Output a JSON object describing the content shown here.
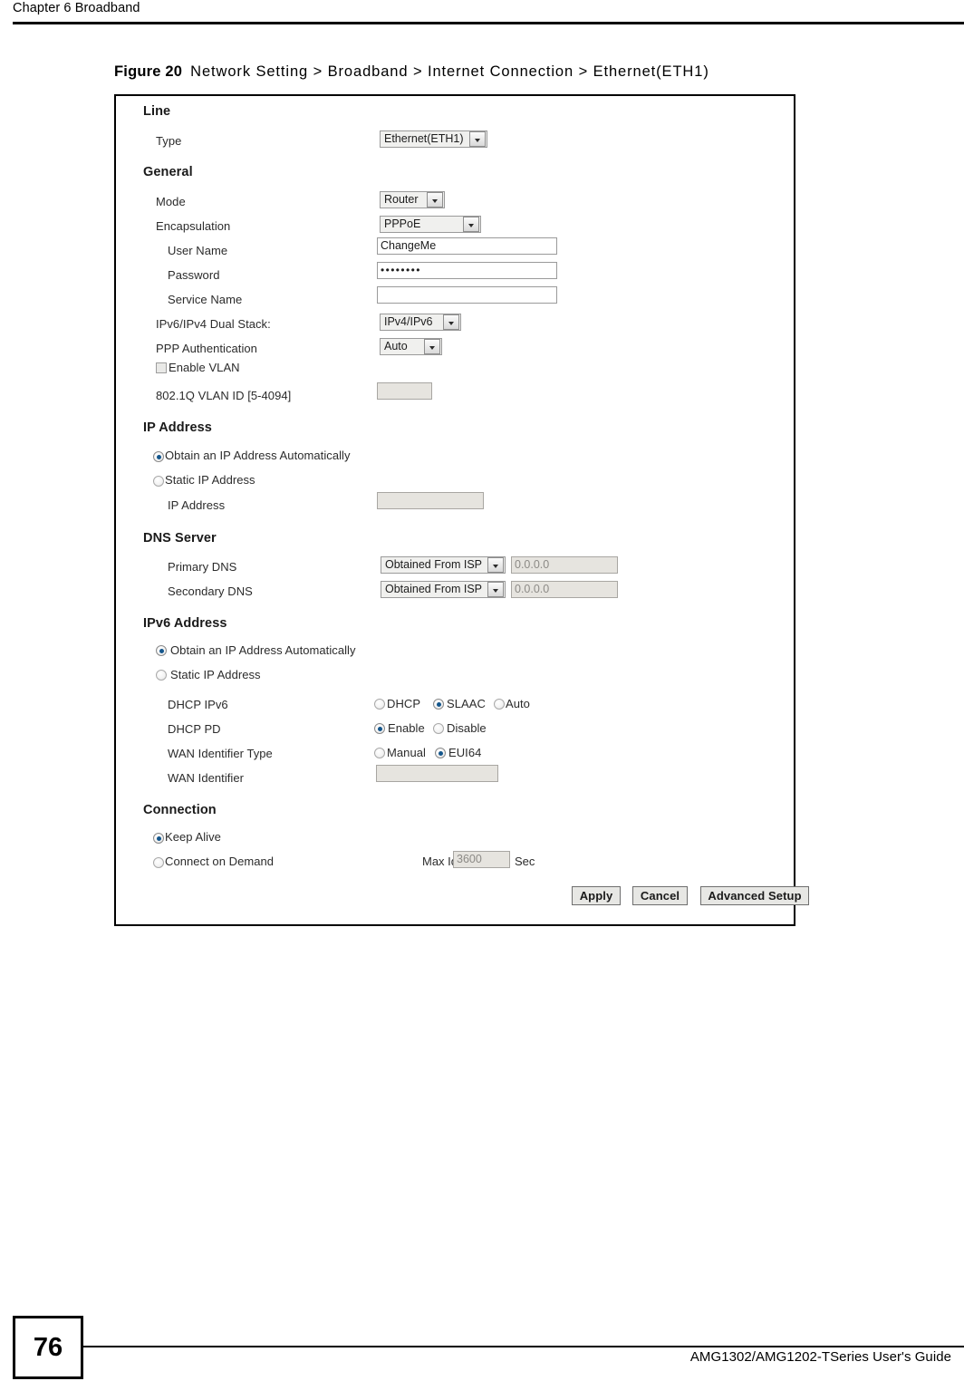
{
  "header": {
    "chapter": "Chapter 6 Broadband"
  },
  "figure": {
    "number": "Figure 20",
    "title": "Network Setting > Broadband > Internet Connection > Ethernet(ETH1)"
  },
  "screen": {
    "sections": {
      "line": "Line",
      "general": "General",
      "ip_address": "IP Address",
      "dns_server": "DNS Server",
      "ipv6_address": "IPv6 Address",
      "connection": "Connection"
    },
    "line": {
      "type_label": "Type",
      "type_value": "Ethernet(ETH1)"
    },
    "general": {
      "mode_label": "Mode",
      "mode_value": "Router",
      "encapsulation_label": "Encapsulation",
      "encapsulation_value": "PPPoE",
      "user_name_label": "User Name",
      "user_name_value": "ChangeMe",
      "password_label": "Password",
      "password_value": "••••••••",
      "service_name_label": "Service Name",
      "service_name_value": "",
      "dual_stack_label": "IPv6/IPv4 Dual Stack:",
      "dual_stack_value": "IPv4/IPv6",
      "ppp_auth_label": "PPP Authentication",
      "ppp_auth_value": "Auto",
      "enable_vlan_label": "Enable VLAN",
      "vlan_id_label": "802.1Q VLAN ID [5-4094]",
      "vlan_id_value": ""
    },
    "ipv4": {
      "obtain_auto_label": "Obtain an IP Address Automatically",
      "static_label": "Static IP Address",
      "ip_address_label": "IP Address",
      "ip_address_value": ""
    },
    "dns": {
      "primary_label": "Primary DNS",
      "primary_mode": "Obtained From ISP",
      "primary_value": "0.0.0.0",
      "secondary_label": "Secondary DNS",
      "secondary_mode": "Obtained From ISP",
      "secondary_value": "0.0.0.0"
    },
    "ipv6": {
      "obtain_auto_label": "Obtain an IP Address Automatically",
      "static_label": "Static IP Address",
      "dhcp_ipv6_label": "DHCP IPv6",
      "dhcp_ipv6_opt_dhcp": "DHCP",
      "dhcp_ipv6_opt_slaac": "SLAAC",
      "dhcp_ipv6_opt_auto": "Auto",
      "dhcp_pd_label": "DHCP PD",
      "dhcp_pd_opt_enable": "Enable",
      "dhcp_pd_opt_disable": "Disable",
      "wan_id_type_label": "WAN Identifier Type",
      "wan_id_type_opt_manual": "Manual",
      "wan_id_type_opt_eui64": "EUI64",
      "wan_identifier_label": "WAN Identifier",
      "wan_identifier_value": ""
    },
    "connection": {
      "keep_alive_label": "Keep Alive",
      "connect_on_demand_label": "Connect on Demand",
      "max_idle_time_label": "Max Idle Time",
      "max_idle_time_value": "3600",
      "max_idle_time_unit": "Sec"
    },
    "buttons": {
      "apply": "Apply",
      "cancel": "Cancel",
      "advanced_setup": "Advanced Setup"
    }
  },
  "footer": {
    "page_number": "76",
    "guide": "AMG1302/AMG1202-TSeries User's Guide"
  }
}
